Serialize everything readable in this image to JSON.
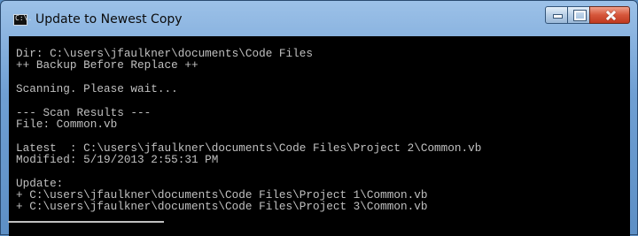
{
  "window": {
    "title": "Update to Newest Copy",
    "icon": "console-app-icon",
    "icon_glyph": "C:\\.",
    "controls": [
      "minimize",
      "maximize",
      "close"
    ]
  },
  "console": {
    "background": "#000000",
    "foreground": "#c0c0c0",
    "lines": [
      "Dir: C:\\users\\jfaulkner\\documents\\Code Files",
      "++ Backup Before Replace ++",
      "",
      "Scanning. Please wait...",
      "",
      "--- Scan Results ---",
      "File: Common.vb",
      "",
      "Latest  : C:\\users\\jfaulkner\\documents\\Code Files\\Project 2\\Common.vb",
      "Modified: 5/19/2013 2:55:31 PM",
      "",
      "Update:",
      "+ C:\\users\\jfaulkner\\documents\\Code Files\\Project 1\\Common.vb",
      "+ C:\\users\\jfaulkner\\documents\\Code Files\\Project 3\\Common.vb"
    ]
  }
}
